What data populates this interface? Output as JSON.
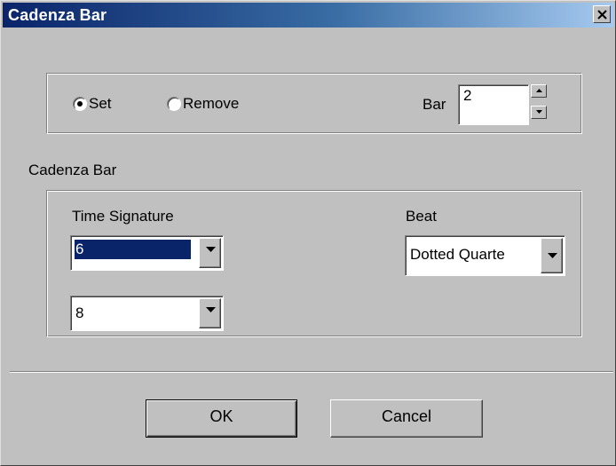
{
  "window": {
    "title": "Cadenza Bar",
    "close_icon": "close-icon"
  },
  "mode": {
    "options": [
      {
        "label": "Set",
        "selected": true
      },
      {
        "label": "Remove",
        "selected": false
      }
    ]
  },
  "bar": {
    "label": "Bar",
    "value": "2"
  },
  "cadenza_section": {
    "heading": "Cadenza Bar",
    "time_signature": {
      "label": "Time Signature",
      "numerator": "6",
      "denominator": "8"
    },
    "beat": {
      "label": "Beat",
      "value": "Dotted Quarte"
    }
  },
  "buttons": {
    "ok": "OK",
    "cancel": "Cancel"
  }
}
